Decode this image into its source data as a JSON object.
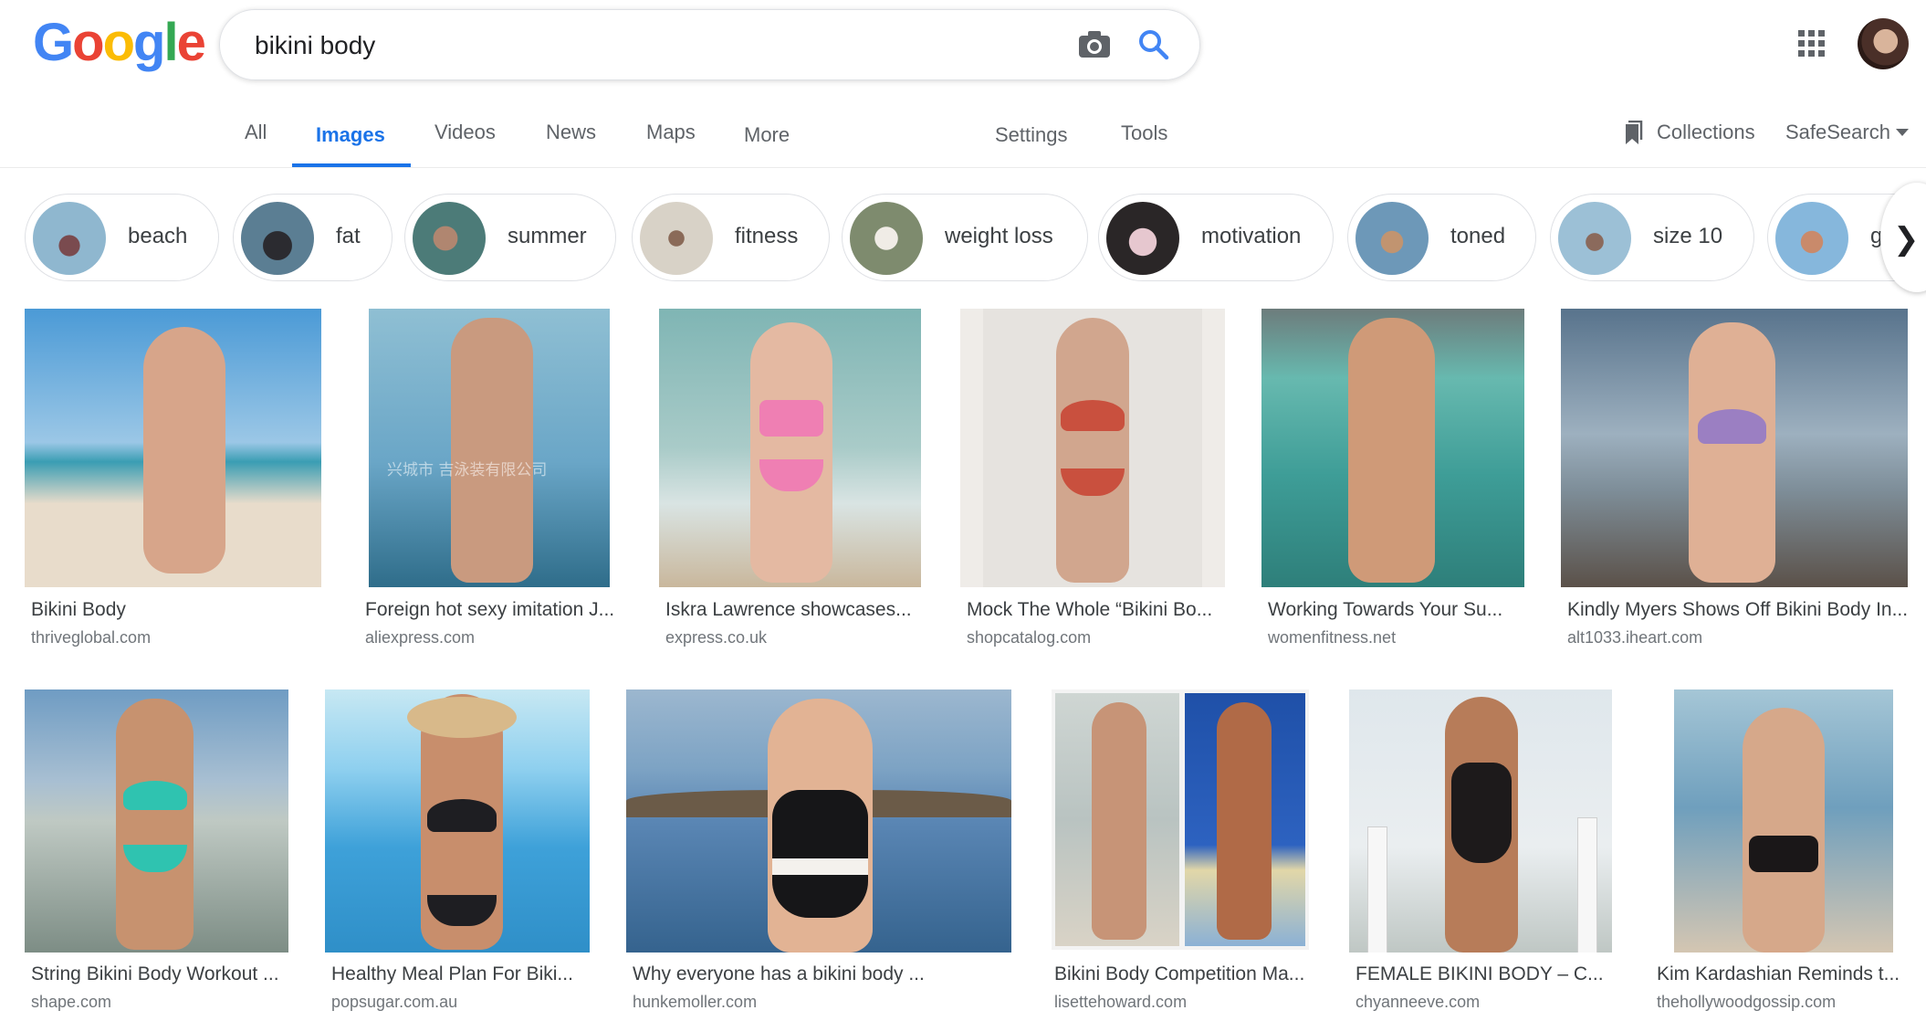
{
  "logo": {
    "letters": [
      "G",
      "o",
      "o",
      "g",
      "l",
      "e"
    ],
    "colors": [
      "#4285F4",
      "#EA4335",
      "#FBBC05",
      "#4285F4",
      "#34A853",
      "#EA4335"
    ]
  },
  "search": {
    "query": "bikini body",
    "placeholder": ""
  },
  "nav": {
    "tabs": [
      "All",
      "Images",
      "Videos",
      "News",
      "Maps",
      "More"
    ],
    "active_tab": "Images",
    "settings": "Settings",
    "tools": "Tools",
    "collections": "Collections",
    "safesearch": "SafeSearch"
  },
  "chips": [
    {
      "label": "beach",
      "thumb_color": "#8fb7cf"
    },
    {
      "label": "fat",
      "thumb_color": "#5b7e93"
    },
    {
      "label": "summer",
      "thumb_color": "#4c7b78"
    },
    {
      "label": "fitness",
      "thumb_color": "#d8d2c7"
    },
    {
      "label": "weight loss",
      "thumb_color": "#7e8b6e"
    },
    {
      "label": "motivation",
      "thumb_color": "#c9a4ad"
    },
    {
      "label": "toned",
      "thumb_color": "#6d98b8"
    },
    {
      "label": "size 10",
      "thumb_color": "#9cc0d6"
    },
    {
      "label": "gy",
      "thumb_color": "#86b7dc"
    }
  ],
  "results": [
    {
      "title": "Bikini Body",
      "source": "thriveglobal.com",
      "colors": [
        "#4b9ad6",
        "#9bc7e6",
        "#e8dccb"
      ]
    },
    {
      "title": "Foreign hot sexy imitation J...",
      "source": "aliexpress.com",
      "colors": [
        "#6aa6c7",
        "#8fbfd3",
        "#2f6d8a"
      ],
      "watermark": "兴城市 吉泳装有限公司"
    },
    {
      "title": "Iskra Lawrence showcases...",
      "source": "express.co.uk",
      "colors": [
        "#7fb5b4",
        "#d9e4e3",
        "#c9b79c"
      ]
    },
    {
      "title": "Mock The Whole “Bikini Bo...",
      "source": "shopcatalog.com",
      "colors": [
        "#e6e3df",
        "#efece8",
        "#d7d2cd"
      ]
    },
    {
      "title": "Working Towards Your Su...",
      "source": "womenfitness.net",
      "colors": [
        "#3e9d97",
        "#67b9af",
        "#2e7f7a"
      ]
    },
    {
      "title": "Kindly Myers Shows Off Bikini Body In...",
      "source": "alt1033.iheart.com",
      "colors": [
        "#58738c",
        "#9db0bf",
        "#5b5149"
      ]
    },
    {
      "title": "String Bikini Body Workout ...",
      "source": "shape.com",
      "colors": [
        "#6f9cc3",
        "#bfc9c3",
        "#7d8d85"
      ]
    },
    {
      "title": "Healthy Meal Plan For Biki...",
      "source": "popsugar.com.au",
      "colors": [
        "#3ea1d9",
        "#8fd0ef",
        "#c7e8f3"
      ]
    },
    {
      "title": "Why everyone has a bikini body ...",
      "source": "hunkemoller.com",
      "colors": [
        "#5a86b4",
        "#35638e",
        "#9cb7cf"
      ]
    },
    {
      "title": "Bikini Body Competition Ma...",
      "source": "lisettehoward.com",
      "colors": [
        "#cfd6d3",
        "#1f50a8",
        "#e2d7a8"
      ]
    },
    {
      "title": "FEMALE BIKINI BODY – C...",
      "source": "chyanneeve.com",
      "colors": [
        "#dfe7ec",
        "#eaeef0",
        "#bfc7c4"
      ]
    },
    {
      "title": "Kim Kardashian Reminds t...",
      "source": "thehollywoodgossip.com",
      "colors": [
        "#6f9fbd",
        "#a5c6d6",
        "#d4c6b2"
      ]
    }
  ]
}
